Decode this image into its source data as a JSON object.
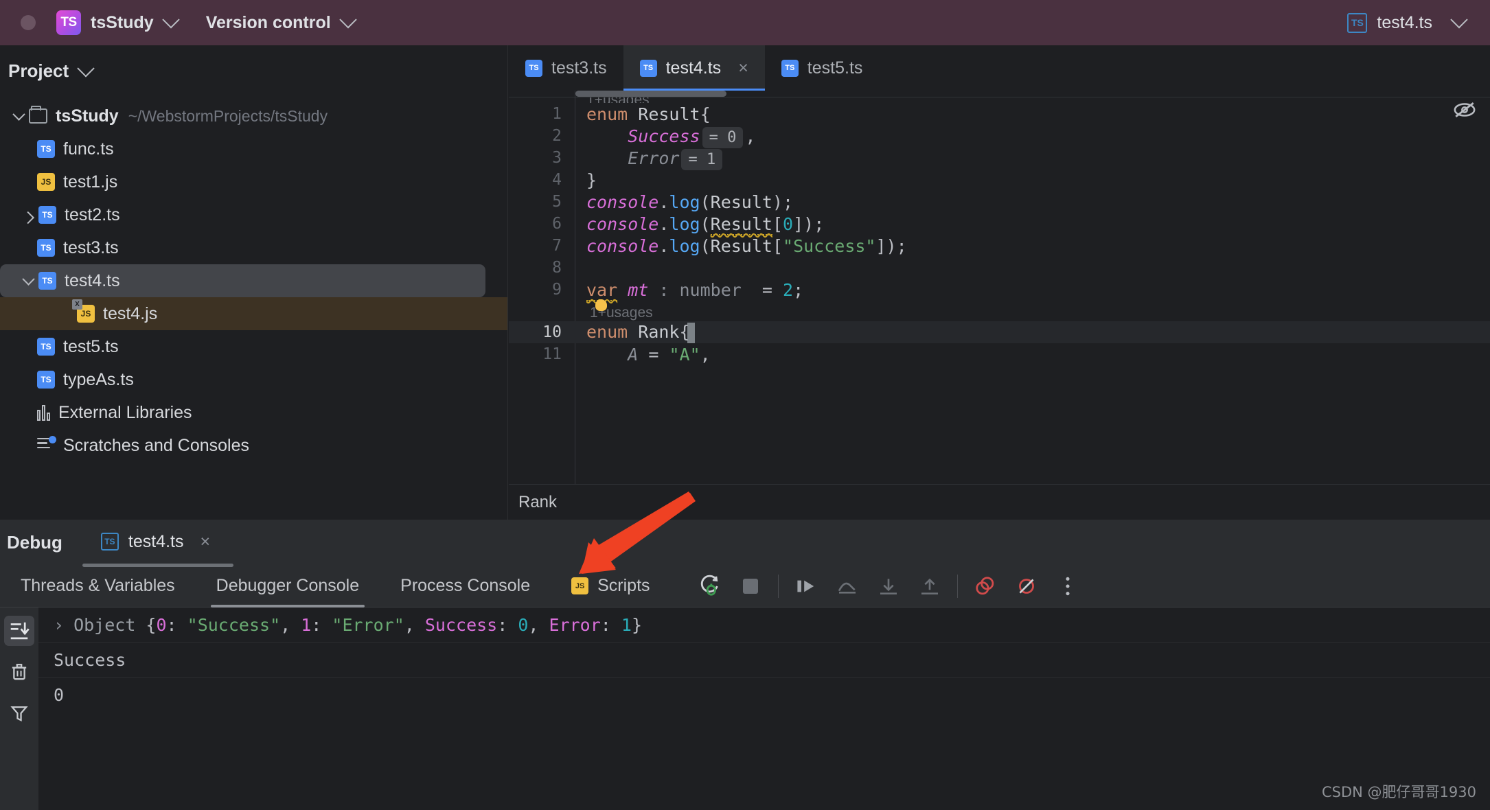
{
  "titlebar": {
    "project_badge": "TS",
    "project_name": "tsStudy",
    "vcs_label": "Version control",
    "run_config_icon": "TS",
    "run_config_name": "test4.ts"
  },
  "sidebar": {
    "title": "Project",
    "tree": [
      {
        "label": "tsStudy",
        "path": "~/WebstormProjects/tsStudy",
        "icon": "folder-icon",
        "twisty": "down",
        "indent": 0,
        "state": "normal"
      },
      {
        "label": "func.ts",
        "path": "",
        "icon": "ts-file-icon",
        "twisty": "none",
        "indent": 1,
        "state": "normal"
      },
      {
        "label": "test1.js",
        "path": "",
        "icon": "js-file-icon",
        "twisty": "none",
        "indent": 1,
        "state": "normal"
      },
      {
        "label": "test2.ts",
        "path": "",
        "icon": "ts-file-icon",
        "twisty": "right",
        "indent": 1,
        "state": "normal"
      },
      {
        "label": "test3.ts",
        "path": "",
        "icon": "ts-file-icon",
        "twisty": "none",
        "indent": 1,
        "state": "normal"
      },
      {
        "label": "test4.ts",
        "path": "",
        "icon": "ts-file-icon",
        "twisty": "down",
        "indent": 1,
        "state": "selected"
      },
      {
        "label": "test4.js",
        "path": "",
        "icon": "js-generated-file-icon",
        "twisty": "none",
        "indent": 2,
        "state": "highlight"
      },
      {
        "label": "test5.ts",
        "path": "",
        "icon": "ts-file-icon",
        "twisty": "none",
        "indent": 1,
        "state": "normal"
      },
      {
        "label": "typeAs.ts",
        "path": "",
        "icon": "ts-file-icon",
        "twisty": "none",
        "indent": 1,
        "state": "normal"
      },
      {
        "label": "External Libraries",
        "path": "",
        "icon": "library-icon",
        "twisty": "none",
        "indent": 0,
        "state": "normal"
      },
      {
        "label": "Scratches and Consoles",
        "path": "",
        "icon": "scratches-icon",
        "twisty": "none",
        "indent": 0,
        "state": "normal"
      }
    ]
  },
  "editor": {
    "tabs": [
      {
        "label": "test3.ts",
        "icon": "ts-file-icon",
        "active": false,
        "closable": false
      },
      {
        "label": "test4.ts",
        "icon": "ts-file-icon",
        "active": true,
        "closable": true
      },
      {
        "label": "test5.ts",
        "icon": "ts-file-icon",
        "active": false,
        "closable": false
      }
    ],
    "close_glyph": "×",
    "breadcrumb": "Rank",
    "reader_mode_icon": "eye-off-icon",
    "gutter_numbers": [
      "1",
      "2",
      "3",
      "4",
      "5",
      "6",
      "7",
      "8",
      "9",
      "10",
      "11"
    ],
    "usage_hint": "1+usages",
    "code_lines": [
      {
        "n": "1",
        "text": "enum Result{"
      },
      {
        "n": "2",
        "text": "    Success = 0,"
      },
      {
        "n": "3",
        "text": "    Error = 1"
      },
      {
        "n": "4",
        "text": "}"
      },
      {
        "n": "5",
        "text": "console.log(Result);"
      },
      {
        "n": "6",
        "text": "console.log(Result[0]);"
      },
      {
        "n": "7",
        "text": "console.log(Result[\"Success\"]);"
      },
      {
        "n": "8",
        "text": ""
      },
      {
        "n": "9",
        "text": "var mt : number  = 2;"
      },
      {
        "n": "10",
        "text": "enum Rank{"
      },
      {
        "n": "11",
        "text": "    A = \"A\","
      }
    ],
    "inlay_hints": [
      "= 0",
      "= 1"
    ],
    "tokens": {
      "kw_enum": "enum",
      "name_result": "Result",
      "brace_open": "{",
      "brace_close": "}",
      "field_success": "Success",
      "field_error": "Error",
      "comma": ",",
      "console": "console",
      "dot": ".",
      "log": "log",
      "paren_open": "(",
      "paren_close": ")",
      "semi": ";",
      "bracket_open": "[",
      "bracket_close": "]",
      "zero": "0",
      "str_success": "\"Success\"",
      "kw_var": "var",
      "var_mt": "mt",
      "type_number": ": number",
      "equals": "=",
      "two": "2",
      "name_rank": "Rank",
      "field_a": "A",
      "str_a": "\"A\""
    }
  },
  "debug": {
    "title": "Debug",
    "session_tab": {
      "label": "test4.ts",
      "icon": "ts-outline-icon",
      "close_glyph": "×"
    },
    "tabs": [
      {
        "label": "Threads & Variables",
        "icon": "",
        "active": false
      },
      {
        "label": "Debugger Console",
        "icon": "",
        "active": true
      },
      {
        "label": "Process Console",
        "icon": "",
        "active": false
      },
      {
        "label": "Scripts",
        "icon": "js-file-icon",
        "active": false
      }
    ],
    "toolbar": [
      {
        "name": "rerun-debug-icon"
      },
      {
        "name": "stop-icon"
      },
      {
        "name": "resume-program-icon"
      },
      {
        "name": "step-over-icon"
      },
      {
        "name": "step-into-icon"
      },
      {
        "name": "step-out-icon"
      },
      {
        "name": "view-breakpoints-icon"
      },
      {
        "name": "mute-breakpoints-icon"
      },
      {
        "name": "more-options-icon"
      }
    ],
    "gutter_buttons": [
      {
        "name": "scroll-to-end-icon",
        "active": true
      },
      {
        "name": "clear-all-icon",
        "active": false
      },
      {
        "name": "filter-icon",
        "active": false
      }
    ],
    "console_lines": [
      {
        "expand_glyph": "›",
        "parts": [
          {
            "t": "Object ",
            "c": "obj"
          },
          {
            "t": "{",
            "c": "plain"
          },
          {
            "t": "0",
            "c": "key"
          },
          {
            "t": ": ",
            "c": "plain"
          },
          {
            "t": "\"Success\"",
            "c": "str"
          },
          {
            "t": ", ",
            "c": "plain"
          },
          {
            "t": "1",
            "c": "key"
          },
          {
            "t": ": ",
            "c": "plain"
          },
          {
            "t": "\"Error\"",
            "c": "str"
          },
          {
            "t": ", ",
            "c": "plain"
          },
          {
            "t": "Success",
            "c": "key"
          },
          {
            "t": ": ",
            "c": "plain"
          },
          {
            "t": "0",
            "c": "num"
          },
          {
            "t": ", ",
            "c": "plain"
          },
          {
            "t": "Error",
            "c": "key"
          },
          {
            "t": ": ",
            "c": "plain"
          },
          {
            "t": "1",
            "c": "num"
          },
          {
            "t": "}",
            "c": "plain"
          }
        ]
      },
      {
        "expand_glyph": "",
        "parts": [
          {
            "t": "Success",
            "c": "plain"
          }
        ]
      },
      {
        "expand_glyph": "",
        "parts": [
          {
            "t": "0",
            "c": "plain"
          }
        ]
      }
    ]
  },
  "watermark": "CSDN @肥仔哥哥1930",
  "colors": {
    "titlebar_bg": "#4a3140",
    "accent_blue": "#4b8cf5",
    "editor_bg": "#1e1f22",
    "panel_bg": "#2b2d30",
    "selection_bg": "#43454a",
    "generated_file_bg": "#3d3223",
    "annotation_red": "#ef4123"
  }
}
